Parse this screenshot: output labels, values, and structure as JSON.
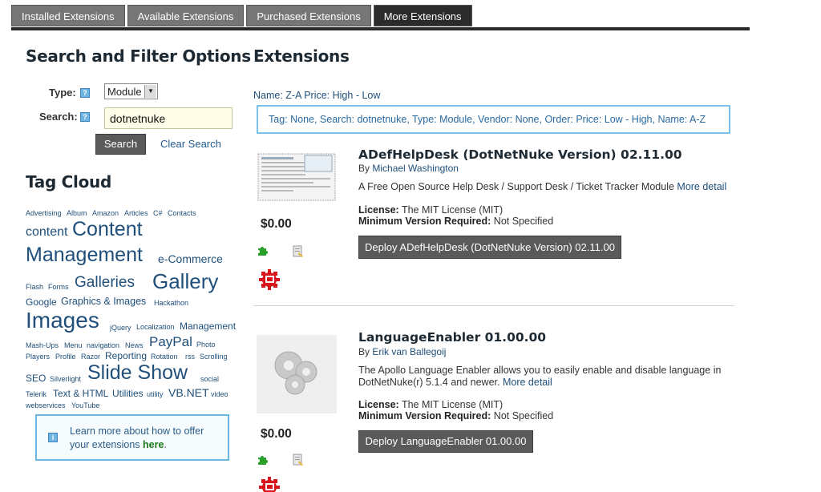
{
  "tabs": [
    "Installed Extensions",
    "Available Extensions",
    "Purchased Extensions",
    "More Extensions"
  ],
  "sidebar": {
    "title": "Search and Filter Options",
    "type_label": "Type:",
    "type_value": "Module",
    "search_label": "Search:",
    "search_value": "dotnetnuke",
    "search_button": "Search",
    "clear_link": "Clear Search",
    "tag_cloud_title": "Tag Cloud",
    "tags": [
      "Advertising",
      "Album",
      "Amazon",
      "Articles",
      "C#",
      "Contacts",
      "content",
      "Content",
      "Management",
      "e-Commerce",
      "Flash",
      "Forms",
      "Galleries",
      "Gallery",
      "Google",
      "Graphics & Images",
      "Hackathon",
      "Images",
      "jQuery",
      "Localization",
      "Management",
      "Mash-Ups",
      "Menu",
      "navigation",
      "News",
      "PayPal",
      "Photo",
      "Players",
      "Profile",
      "Razor",
      "Reporting",
      "Rotation",
      "rss",
      "Scrolling",
      "SEO",
      "Silverlight",
      "Slide Show",
      "social",
      "Telerik",
      "Text & HTML",
      "Utilities",
      "utility",
      "VB.NET",
      "video",
      "webservices",
      "YouTube"
    ],
    "learn_text": "Learn more about how to offer your extensions ",
    "learn_link": "here",
    "learn_end": "."
  },
  "main": {
    "title": "Extensions",
    "sort_line": "Name: Z-A Price: High - Low",
    "filter_summary": "Tag: None, Search: dotnetnuke, Type: Module, Vendor: None, Order: Price: Low - High, Name: A-Z",
    "extensions": [
      {
        "name": "ADefHelpDesk (DotNetNuke Version) 02.11.00",
        "by_label": "By",
        "author": "Michael Washington",
        "description": "A Free Open Source Help Desk / Support Desk / Ticket Tracker Module",
        "more": "More detail",
        "license_label": "License:",
        "license": "The MIT License (MIT)",
        "minver_label": "Minimum Version Required:",
        "minver": "Not Specified",
        "price": "$0.00",
        "deploy": "Deploy ADefHelpDesk (DotNetNuke Version) 02.11.00"
      },
      {
        "name": "LanguageEnabler 01.00.00",
        "by_label": "By",
        "author": "Erik van Ballegoij",
        "description": "The Apollo Language Enabler allows you to easily enable and disable language in DotNetNuke(r) 5.1.4 and newer.",
        "more": "More detail",
        "license_label": "License:",
        "license": "The MIT License (MIT)",
        "minver_label": "Minimum Version Required:",
        "minver": "Not Specified",
        "price": "$0.00",
        "deploy": "Deploy LanguageEnabler 01.00.00"
      }
    ]
  },
  "colors": {
    "accent": "#79c1e6",
    "link": "#1f4f7a",
    "tab_active": "#2b2b2b",
    "tab": "#767676"
  },
  "icons": [
    "help-icon",
    "puzzle-icon",
    "document-icon",
    "gear-icon",
    "info-icon"
  ]
}
